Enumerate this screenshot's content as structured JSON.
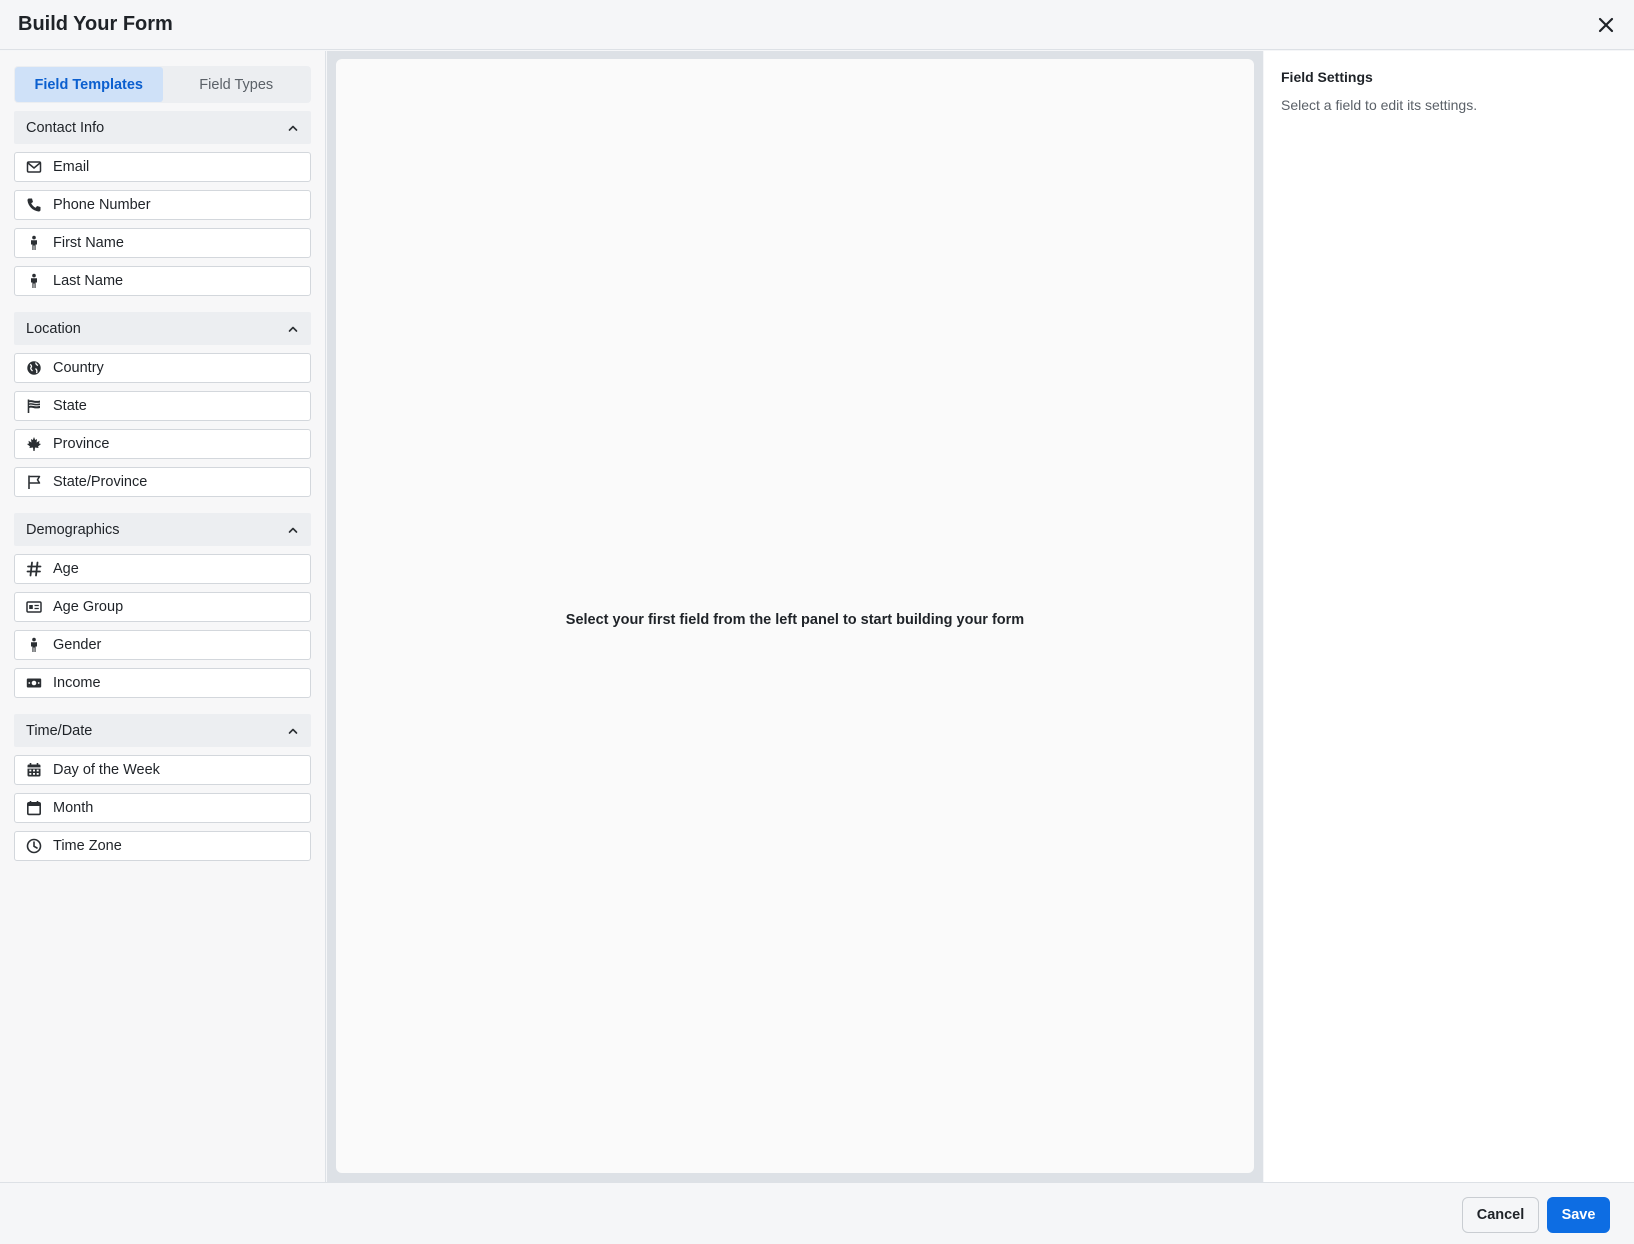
{
  "header": {
    "title": "Build Your Form"
  },
  "tabs": [
    {
      "label": "Field Templates",
      "active": true
    },
    {
      "label": "Field Types",
      "active": false
    }
  ],
  "sections": [
    {
      "label": "Contact Info",
      "items": [
        {
          "label": "Email",
          "icon": "envelope-icon"
        },
        {
          "label": "Phone Number",
          "icon": "phone-icon"
        },
        {
          "label": "First Name",
          "icon": "person-icon"
        },
        {
          "label": "Last Name",
          "icon": "person-icon"
        }
      ]
    },
    {
      "label": "Location",
      "items": [
        {
          "label": "Country",
          "icon": "globe-icon"
        },
        {
          "label": "State",
          "icon": "flag-wavy-icon"
        },
        {
          "label": "Province",
          "icon": "maple-leaf-icon"
        },
        {
          "label": "State/Province",
          "icon": "flag-outline-icon"
        }
      ]
    },
    {
      "label": "Demographics",
      "items": [
        {
          "label": "Age",
          "icon": "hash-icon"
        },
        {
          "label": "Age Group",
          "icon": "id-card-icon"
        },
        {
          "label": "Gender",
          "icon": "person-icon"
        },
        {
          "label": "Income",
          "icon": "money-icon"
        }
      ]
    },
    {
      "label": "Time/Date",
      "items": [
        {
          "label": "Day of the Week",
          "icon": "calendar-grid-icon"
        },
        {
          "label": "Month",
          "icon": "calendar-icon"
        },
        {
          "label": "Time Zone",
          "icon": "clock-icon"
        }
      ]
    }
  ],
  "canvas": {
    "empty_message": "Select your first field from the left panel to start building your form"
  },
  "settings": {
    "title": "Field Settings",
    "hint": "Select a field to edit its settings."
  },
  "footer": {
    "cancel_label": "Cancel",
    "save_label": "Save"
  },
  "colors": {
    "accent": "#0d6de3",
    "tab_active_bg": "#cfe1f8",
    "tab_active_text": "#0b5fcf"
  }
}
